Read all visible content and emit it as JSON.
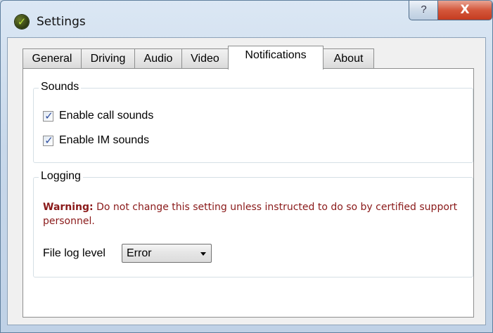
{
  "window": {
    "title": "Settings",
    "help_label": "?",
    "close_label": "X"
  },
  "tabs": [
    {
      "label": "General",
      "active": false
    },
    {
      "label": "Driving",
      "active": false
    },
    {
      "label": "Audio",
      "active": false
    },
    {
      "label": "Video",
      "active": false
    },
    {
      "label": "Notifications",
      "active": true
    },
    {
      "label": "About",
      "active": false
    }
  ],
  "sounds": {
    "title": "Sounds",
    "call_sounds": {
      "label": "Enable call sounds",
      "checked": true
    },
    "im_sounds": {
      "label": "Enable IM sounds",
      "checked": true
    }
  },
  "logging": {
    "title": "Logging",
    "warning_prefix": "Warning:",
    "warning_text": " Do not change this setting unless instructed to do so by certified support personnel.",
    "file_log_label": "File log level",
    "file_log_value": "Error"
  },
  "icons": {
    "app": "app-logo-icon",
    "check": "checkmark-icon",
    "dropdown": "chevron-down-icon"
  },
  "colors": {
    "warning": "#8a1919",
    "close_button": "#c53c20",
    "checkmark": "#2f4f9f"
  }
}
